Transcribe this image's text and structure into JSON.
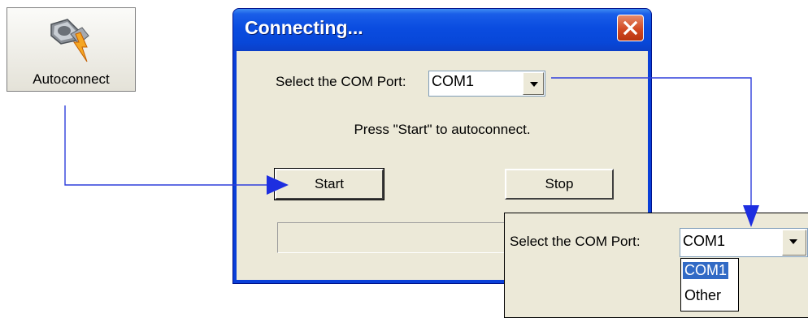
{
  "autoconnect_button": {
    "label": "Autoconnect",
    "icon": "plug-connector-icon"
  },
  "dialog": {
    "title": "Connecting...",
    "com_port_label": "Select the COM Port:",
    "com_port_value": "COM1",
    "status_text": "Press \"Start\" to autoconnect.",
    "start_label": "Start",
    "stop_label": "Stop",
    "progress": 0
  },
  "inset": {
    "com_port_label": "Select the COM Port:",
    "com_port_value": "COM1",
    "options": [
      "COM1",
      "Other"
    ],
    "selected_option": "COM1"
  },
  "colors": {
    "title_bar": "#0a4ce0",
    "dialog_face": "#ece9d8",
    "close_button": "#d24a23",
    "arrow_lines": "#2f3fdc",
    "selection": "#316ac5"
  }
}
